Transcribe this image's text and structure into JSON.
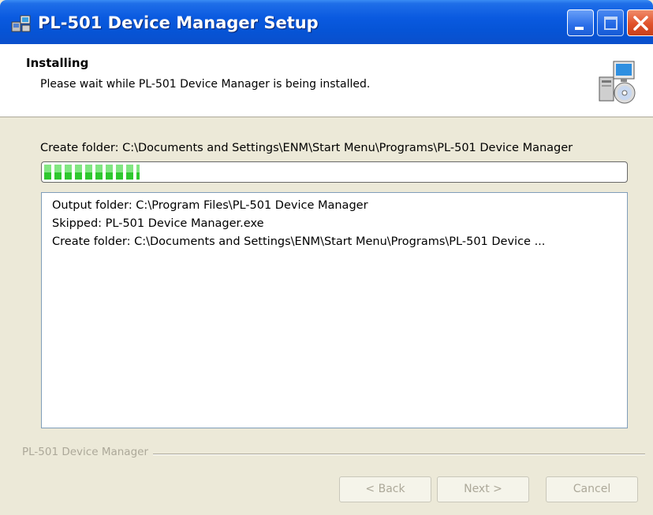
{
  "window": {
    "title": "PL-501 Device Manager Setup",
    "controls": [
      "minimize-icon",
      "maximize-icon",
      "close-icon"
    ]
  },
  "header": {
    "title": "Installing",
    "subtitle": "Please wait while PL-501 Device Manager is being installed.",
    "icon": "installer-cd-icon"
  },
  "status": {
    "text": "Create folder: C:\\Documents and Settings\\ENM\\Start Menu\\Programs\\PL-501 Device Manager"
  },
  "progress": {
    "fraction": 0.165
  },
  "log": {
    "lines": [
      "Output folder: C:\\Program Files\\PL-501 Device Manager",
      "Skipped: PL-501 Device Manager.exe",
      "Create folder: C:\\Documents and Settings\\ENM\\Start Menu\\Programs\\PL-501 Device ..."
    ]
  },
  "branding": {
    "text": "PL-501 Device Manager"
  },
  "buttons": {
    "back": "< Back",
    "next": "Next >",
    "cancel": "Cancel"
  },
  "colors": {
    "titlebar": "#0a5ae0",
    "progress_fill": "#2ec82e",
    "disabled_text": "#aca899",
    "dialog_bg": "#ece9d8"
  }
}
